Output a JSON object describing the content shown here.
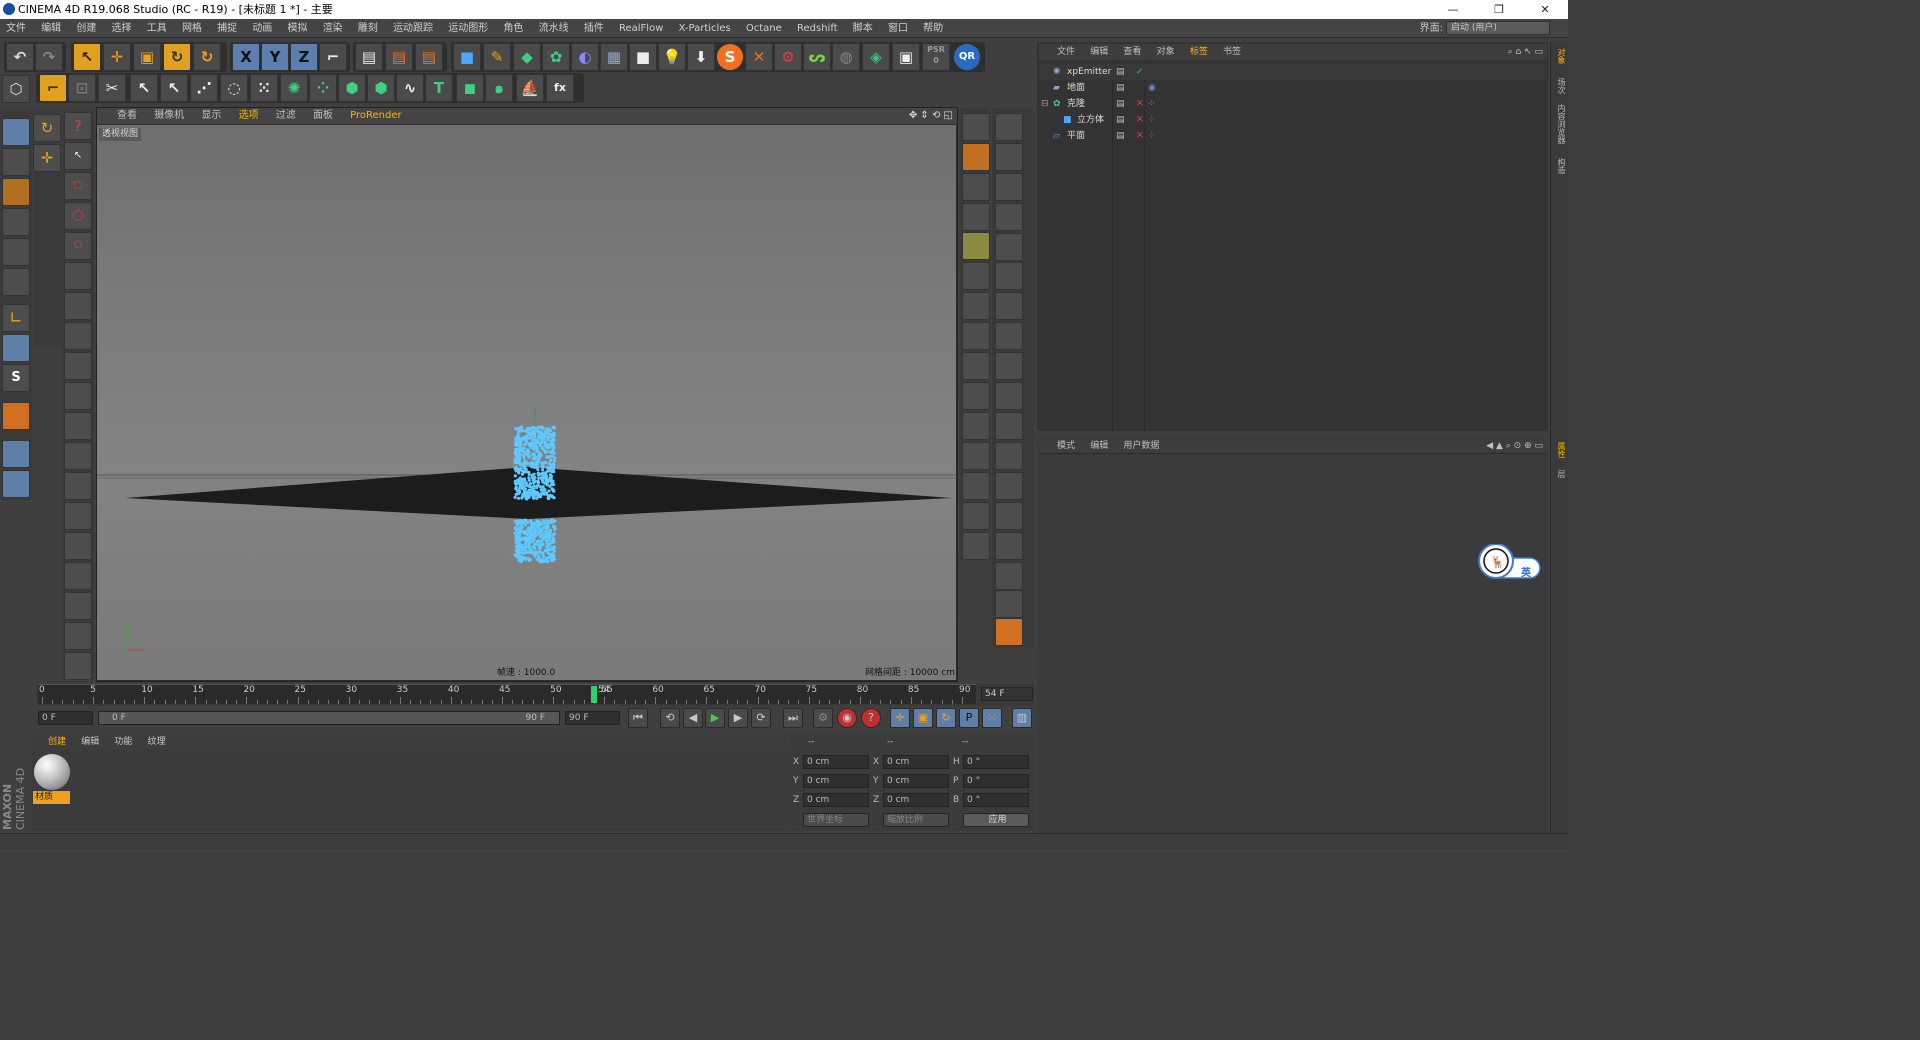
{
  "window": {
    "title": "CINEMA 4D R19.068 Studio (RC - R19) - [未标题 1 *] - 主要",
    "min": "—",
    "restore": "❐",
    "close": "✕"
  },
  "menu": [
    "文件",
    "编辑",
    "创建",
    "选择",
    "工具",
    "网格",
    "捕捉",
    "动画",
    "模拟",
    "渲染",
    "雕刻",
    "运动跟踪",
    "运动图形",
    "角色",
    "流水线",
    "插件",
    "RealFlow",
    "X-Particles",
    "Octane",
    "Redshift",
    "脚本",
    "窗口",
    "帮助"
  ],
  "layout": {
    "label": "界面:",
    "value": "启动 (用户)"
  },
  "toolbar": {
    "x": "X",
    "y": "Y",
    "z": "Z",
    "psr_label": "PSR",
    "psr_value": "0",
    "qr": "QR",
    "s": "S",
    "fx": "fx"
  },
  "left_tools": {
    "s": "S"
  },
  "viewport": {
    "menu": [
      "查看",
      "摄像机",
      "显示",
      "选项",
      "过滤",
      "面板",
      "ProRender"
    ],
    "menu_highlight": "选项",
    "label": "透视视图",
    "fps_text": "帧速 : 1000.0",
    "grid_text": "网格间距 : 10000 cm"
  },
  "object_manager": {
    "menu": [
      "文件",
      "编辑",
      "查看",
      "对象",
      "标签",
      "书签"
    ],
    "objects": [
      {
        "name": "xpEmitter"
      },
      {
        "name": "地面"
      },
      {
        "name": "克隆"
      },
      {
        "name": "立方体"
      },
      {
        "name": "平面"
      }
    ]
  },
  "attribute_manager": {
    "menu": [
      "模式",
      "编辑",
      "用户数据"
    ]
  },
  "side_tabs": [
    "对象",
    "场次",
    "内容浏览器",
    "构造",
    "属性",
    "层"
  ],
  "timeline": {
    "ticks": [
      "0",
      "5",
      "10",
      "15",
      "20",
      "25",
      "30",
      "35",
      "40",
      "45",
      "50",
      "55",
      "60",
      "65",
      "70",
      "75",
      "80",
      "85",
      "90"
    ],
    "current_frame": "54 F",
    "current_value": 54,
    "max_value": 90
  },
  "transport": {
    "start": "0 F",
    "range_start": "0 F",
    "range_end": "90 F",
    "end": "90 F"
  },
  "material_manager": {
    "menu": [
      "创建",
      "编辑",
      "功能",
      "纹理"
    ],
    "material_name": "材质"
  },
  "coordinates": {
    "headers": [
      "--",
      "--",
      "--"
    ],
    "rows": [
      {
        "a": "X",
        "av": "0 cm",
        "b": "X",
        "bv": "0 cm",
        "c": "H",
        "cv": "0 °"
      },
      {
        "a": "Y",
        "av": "0 cm",
        "b": "Y",
        "bv": "0 cm",
        "c": "P",
        "cv": "0 °"
      },
      {
        "a": "Z",
        "av": "0 cm",
        "b": "Z",
        "bv": "0 cm",
        "c": "B",
        "cv": "0 °"
      }
    ],
    "world": "世界坐标",
    "scale": "缩放比例",
    "apply": "应用"
  },
  "brand": {
    "maxon": "MAXON",
    "c4d": "CINEMA 4D"
  },
  "ime": {
    "label": "英"
  },
  "colors": {
    "accent": "#ffb400",
    "particles": "#5ec8ff",
    "cursor": "#30d070"
  }
}
